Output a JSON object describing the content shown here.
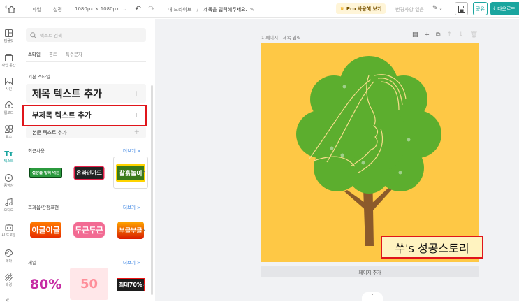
{
  "topbar": {
    "file_menu": "파일",
    "settings_menu": "설정",
    "size_label": "1080px × 1080px",
    "breadcrumb_root": "내 드라이브",
    "breadcrumb_sep": "/",
    "title_placeholder": "제목을 입력해주세요.",
    "pro_button": "Pro 사용해 보기",
    "status": "변경사항 없음",
    "share_button": "공유",
    "download_button": "다운로드"
  },
  "rail": {
    "items": [
      {
        "label": "템플릿",
        "icon": "template-icon"
      },
      {
        "label": "작업 공간",
        "icon": "workspace-icon"
      },
      {
        "label": "사진",
        "icon": "photo-icon"
      },
      {
        "label": "업로드",
        "icon": "upload-icon"
      },
      {
        "label": "요소",
        "icon": "elements-icon"
      },
      {
        "label": "텍스트",
        "icon": "text-icon"
      },
      {
        "label": "동영상",
        "icon": "video-icon"
      },
      {
        "label": "오디오",
        "icon": "audio-icon"
      },
      {
        "label": "AI 드로잉",
        "icon": "ai-drawing-icon"
      },
      {
        "label": "테마",
        "icon": "theme-icon"
      },
      {
        "label": "배경",
        "icon": "background-icon"
      }
    ],
    "active_color": "#1aa59f"
  },
  "panel": {
    "search_placeholder": "텍스트 검색",
    "tabs": [
      "스타일",
      "폰트",
      "특수문자"
    ],
    "basic_style_label": "기본 스타일",
    "heading_text": "제목 텍스트 추가",
    "subheading_text": "부제목 텍스트 추가",
    "body_text": "본문 텍스트 추가",
    "recent_label": "최근사용",
    "effects_label": "효과음/감정표현",
    "sale_label": "세일",
    "more_label": "더보기 >",
    "recent_thumbs": [
      "설탕을 입혀 먹는",
      "온라인가드",
      "찰흙놀이"
    ],
    "effect_thumbs": [
      "이글이글",
      "두근두근",
      "부글부글"
    ],
    "sale_thumbs": [
      "80%",
      "50",
      "최대70%"
    ]
  },
  "canvas": {
    "page_label": "1 페이지 - 제목 입력",
    "add_page": "페이지 추가",
    "canvas_bg": "#fec845",
    "caption": "쑤's 성공스토리",
    "highlight_color": "#e0151b",
    "accent_color": "#1aa59f"
  }
}
